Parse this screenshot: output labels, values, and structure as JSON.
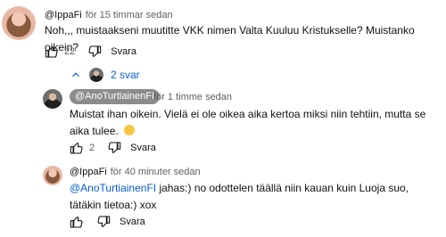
{
  "comments": [
    {
      "author": "@IppaFi",
      "time": "för 15 timmar sedan",
      "text": "Noh,,, muistaakseni muutitte VKK nimen Valta Kuuluu Kristukselle? Muistanko oikein?",
      "likes": "22",
      "reply_label": "Svara"
    }
  ],
  "replies_toggle": {
    "label": "2 svar"
  },
  "replies": [
    {
      "author": "@AnoTurtiainenFI",
      "time": "för 1 timme sedan",
      "text": "Muistat ihan oikein. Vielä ei ole oikea aika kertoa miksi niin tehtiin, mutta se aika tulee.",
      "likes": "2",
      "reply_label": "Svara"
    },
    {
      "author": "@IppaFi",
      "time": "för 40 minuter sedan",
      "mention": "@AnoTurtiainenFI",
      "text": "jahas:) no odottelen täällä niin kauan kuin Luoja suo, tätäkin tietoa:) xox",
      "reply_label": "Svara"
    }
  ],
  "icons": {
    "like": "thumbs-up-icon",
    "dislike": "thumbs-down-icon",
    "chevron": "chevron-up-icon",
    "emoji": "smiling-emoji-icon"
  }
}
